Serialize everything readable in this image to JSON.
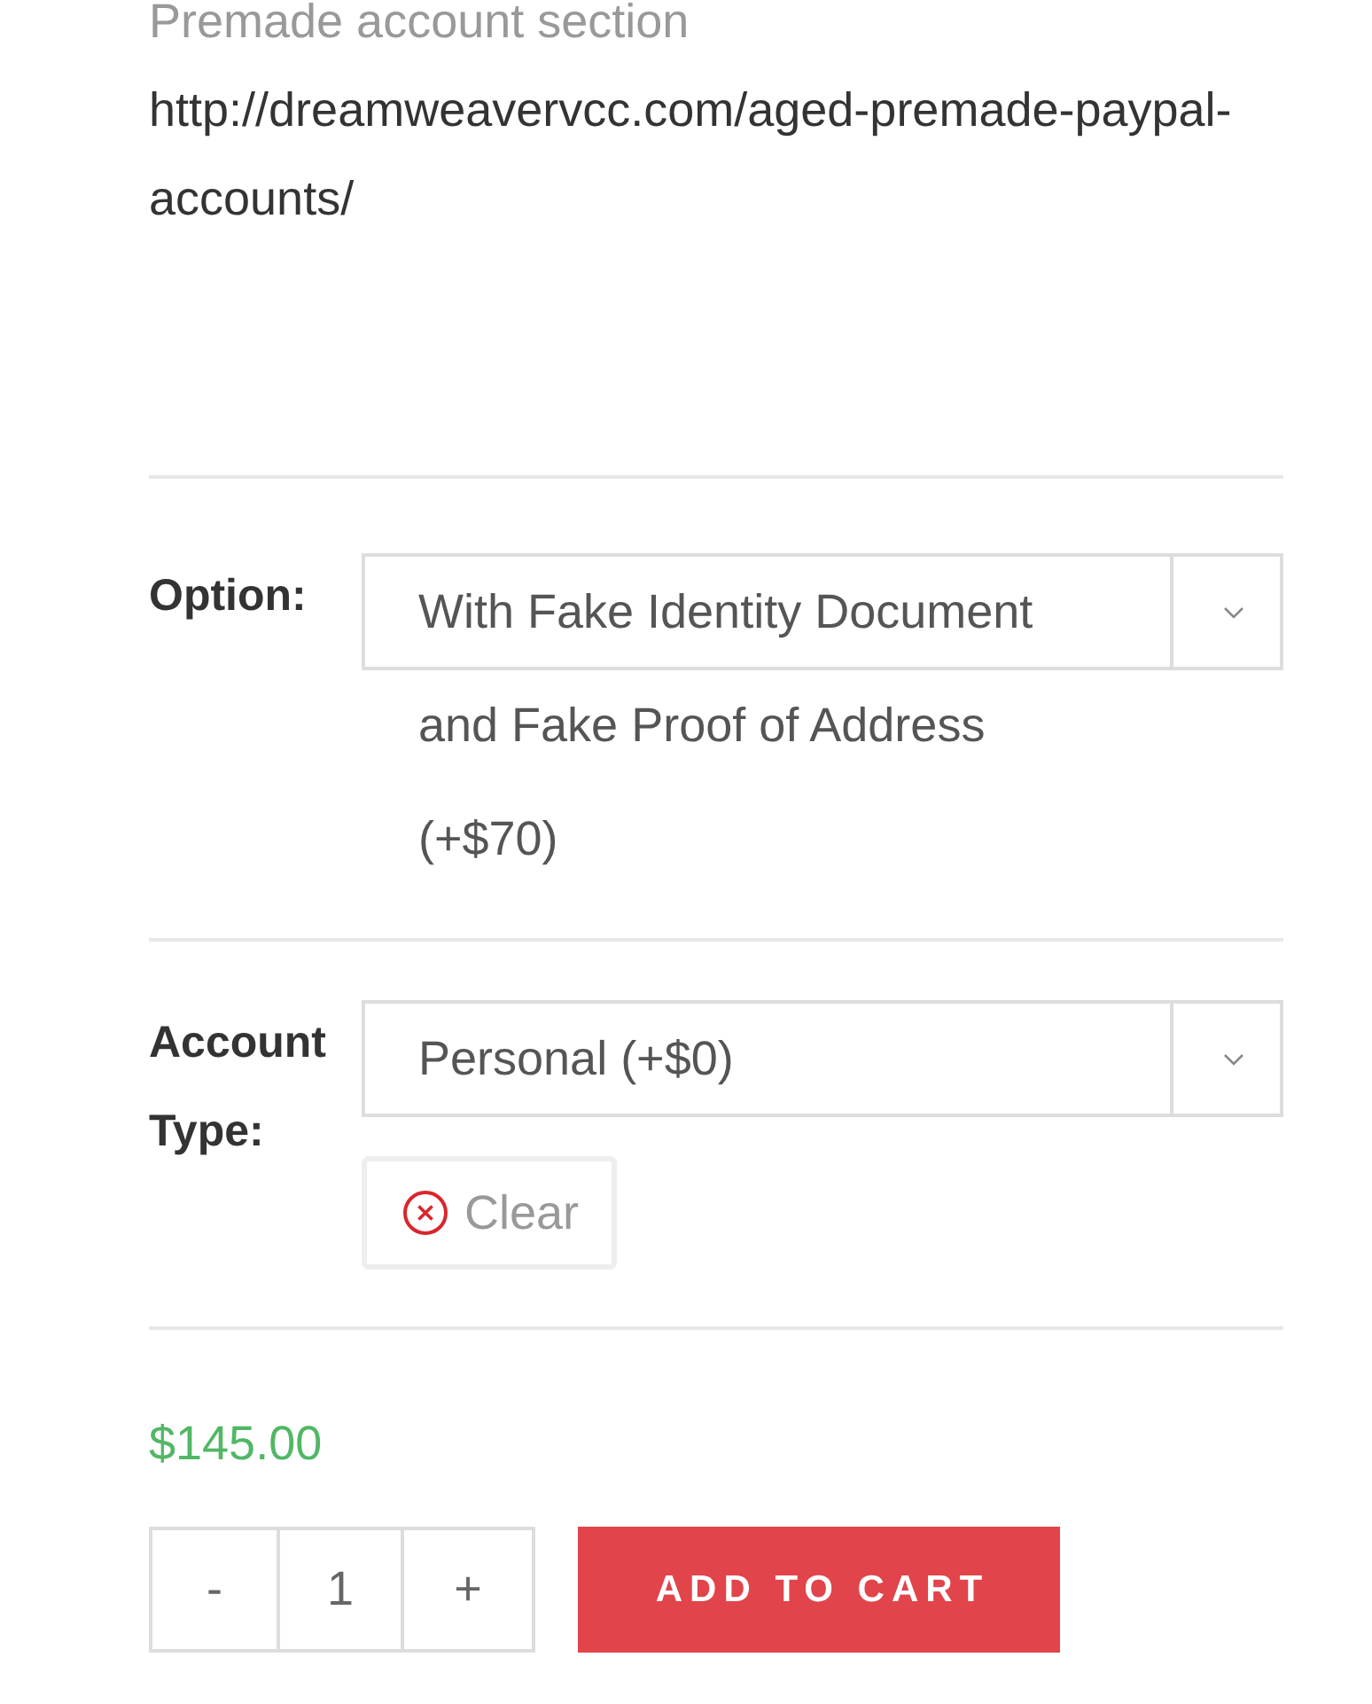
{
  "intro": {
    "heading": "Premade account section",
    "url": "http://dreamweavervcc.com/aged-premade-paypal-accounts/"
  },
  "variations": [
    {
      "label": "Option:",
      "value": "With Fake Identity Document and Fake Proof of Address (+$70)"
    },
    {
      "label": "Account Type:",
      "value": "Personal (+$0)",
      "clear_label": "Clear"
    }
  ],
  "price": "$145.00",
  "quantity": {
    "minus": "-",
    "value": "1",
    "plus": "+"
  },
  "add_to_cart": "ADD TO CART"
}
